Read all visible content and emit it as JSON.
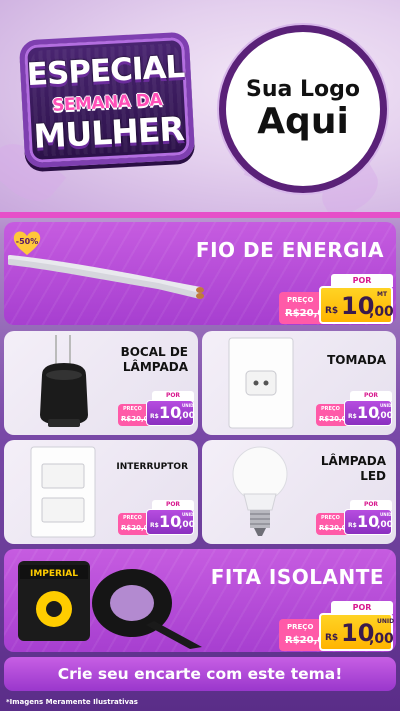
{
  "badge": {
    "line1": "ESPECIAL",
    "line2": "SEMANA DA",
    "line3": "MULHER"
  },
  "logo": {
    "line1": "Sua Logo",
    "line2": "Aqui"
  },
  "products": {
    "fio": {
      "title": "FIO DE ENERGIA",
      "discount": "-50%",
      "por": "POR",
      "old_label": "PREÇO",
      "old_value": "R$20,00",
      "currency": "R$",
      "price_int": "10",
      "price_dec": ",00",
      "unit": "MT"
    },
    "bocal": {
      "title_line1": "BOCAL DE",
      "title_line2": "LÂMPADA",
      "por": "POR",
      "old_label": "PREÇO",
      "old_value": "R$20,00",
      "currency": "R$",
      "price_int": "10",
      "price_dec": ",00",
      "unit": "UNID"
    },
    "tomada": {
      "title": "TOMADA",
      "por": "POR",
      "old_label": "PREÇO",
      "old_value": "R$20,00",
      "currency": "R$",
      "price_int": "10",
      "price_dec": ",00",
      "unit": "UNID"
    },
    "interruptor": {
      "title": "INTERRUPTOR",
      "por": "POR",
      "old_label": "PREÇO",
      "old_value": "R$20,00",
      "currency": "R$",
      "price_int": "10",
      "price_dec": ",00",
      "unit": "UNID"
    },
    "lampada": {
      "title_line1": "LÂMPADA",
      "title_line2": "LED",
      "brand": "",
      "por": "POR",
      "old_label": "PREÇO",
      "old_value": "R$20,00",
      "currency": "R$",
      "price_int": "10",
      "price_dec": ",00",
      "unit": "UNID"
    },
    "fita": {
      "title": "FITA ISOLANTE",
      "brand": "IMPERIAL",
      "por": "POR",
      "old_label": "PREÇO",
      "old_value": "R$20,00",
      "currency": "R$",
      "price_int": "10",
      "price_dec": ",00",
      "unit": "UNID"
    }
  },
  "cta": "Crie seu encarte com este tema!",
  "disclaimer": "*Imagens Meramente Ilustrativas",
  "colors": {
    "accent_purple": "#a73fd0",
    "pink": "#e64fc9",
    "yellow": "#ffc400"
  }
}
